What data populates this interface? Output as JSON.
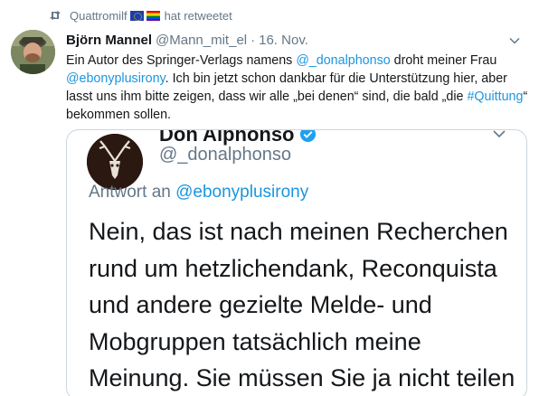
{
  "retweet": {
    "user": "Quattromilf",
    "flags": [
      "eu-flag",
      "rainbow-flag"
    ],
    "suffix": "hat retweetet"
  },
  "tweet": {
    "author_name": "Björn Mannel",
    "author_handle": "@Mann_mit_el",
    "separator": "·",
    "date": "16. Nov.",
    "text": {
      "p1": "Ein Autor des Springer-Verlags namens ",
      "mention1": "@_donalphonso",
      "p2": " droht meiner Frau ",
      "mention2": "@ebonyplusirony",
      "p3": ". Ich bin jetzt schon dankbar für die Unterstützung hier, aber lasst uns ihm bitte zeigen, dass wir alle „bei denen“ sind, die bald „die ",
      "hashtag": "#Quittung",
      "p4": "“ bekommen sollen."
    }
  },
  "quoted": {
    "name": "Don Alphonso",
    "handle": "@_donalphonso",
    "reply_label": "Antwort an ",
    "reply_to": "@ebonyplusirony",
    "body": "Nein, das ist nach meinen Recherchen rund um hetzlichendank, Reconquista und andere gezielte Melde- und Mobgruppen tatsächlich meine Meinung. Sie müssen Sie ja nicht teilen"
  },
  "colors": {
    "link": "#1b95e0",
    "muted": "#657786",
    "text": "#14171a"
  }
}
